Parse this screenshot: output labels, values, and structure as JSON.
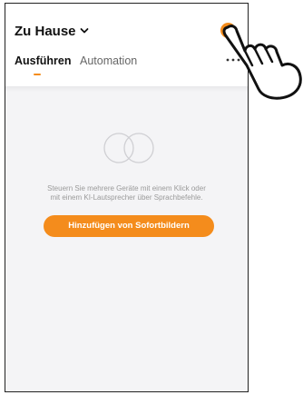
{
  "header": {
    "home_title": "Zu Hause",
    "accent_color": "#f48c1c",
    "add_icon": "plus-circle-icon"
  },
  "tabs": [
    {
      "label": "Ausführen",
      "active": true
    },
    {
      "label": "Automation",
      "active": false
    }
  ],
  "more_icon": "more-horizontal-icon",
  "empty_state": {
    "icon": "overlapping-circles-icon",
    "line1": "Steuern Sie mehrere Geräte mit einem Klick oder",
    "line2": "mit einem KI-Lautsprecher über Sprachbefehle.",
    "button_label": "Hinzufügen von Sofortbildern"
  },
  "annotation": {
    "icon": "pointing-hand-icon"
  }
}
